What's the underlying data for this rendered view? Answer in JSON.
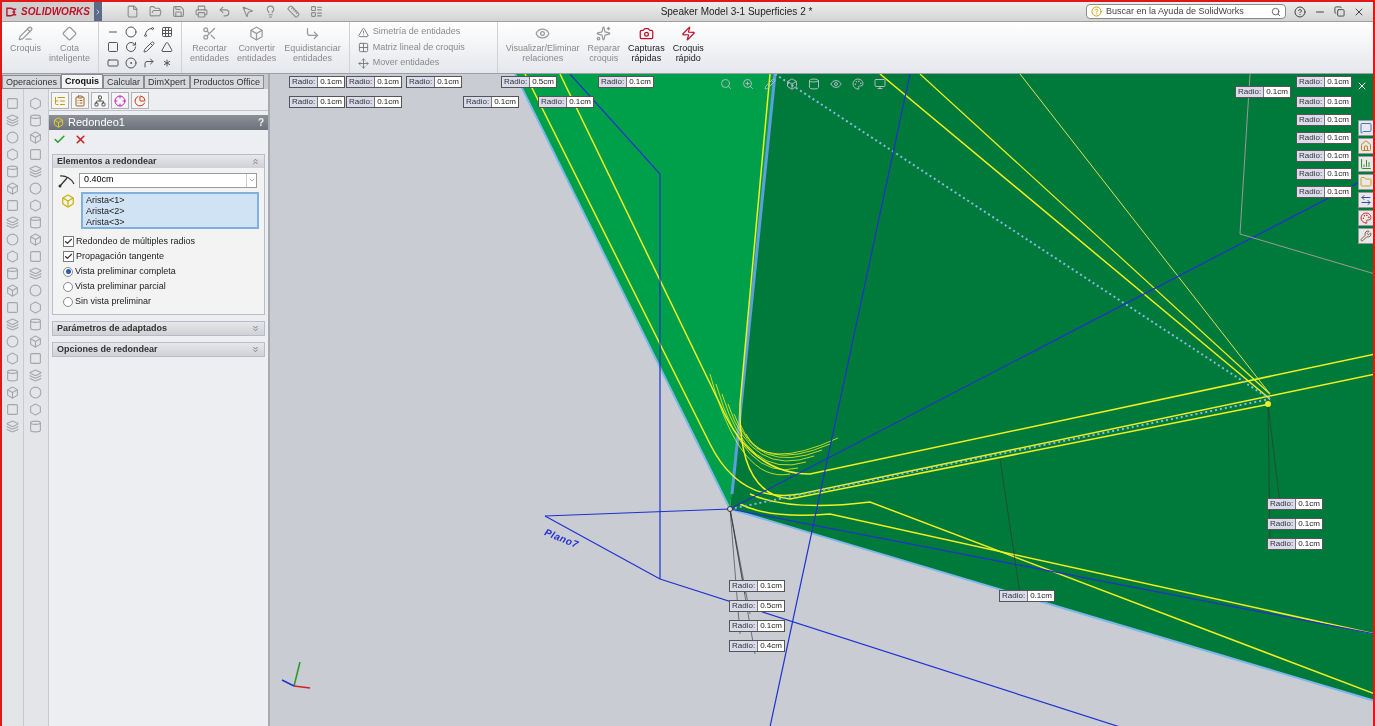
{
  "window": {
    "app_name": "SOLIDWORKS",
    "title": "Speaker Model 3-1 Superficies 2 *",
    "help_search": {
      "placeholder": "Buscar en la Ayuda de SolidWorks"
    }
  },
  "ribbon": [
    {
      "kind": "button",
      "lines": [
        "Croquis"
      ],
      "disabled": true
    },
    {
      "kind": "button",
      "lines": [
        "Cota",
        "inteligente"
      ],
      "disabled": true
    },
    {
      "kind": "tool_grid"
    },
    {
      "kind": "button",
      "lines": [
        "Recortar",
        "entidades"
      ],
      "disabled": true
    },
    {
      "kind": "button",
      "lines": [
        "Convertir",
        "entidades"
      ],
      "disabled": true
    },
    {
      "kind": "button",
      "lines": [
        "Equidistanciar",
        "entidades"
      ],
      "disabled": true
    },
    {
      "kind": "stack",
      "items": [
        {
          "label": "Simetría de entidades",
          "disabled": true
        },
        {
          "label": "Matriz lineal de croquis",
          "disabled": true
        },
        {
          "label": "Mover entidades",
          "disabled": true
        }
      ]
    },
    {
      "kind": "button",
      "lines": [
        "Visualizar/Eliminar",
        "relaciones"
      ],
      "disabled": true
    },
    {
      "kind": "button",
      "lines": [
        "Reparar",
        "croquis"
      ],
      "disabled": true
    },
    {
      "kind": "button",
      "lines": [
        "Capturas",
        "rápidas"
      ],
      "disabled": false
    },
    {
      "kind": "button",
      "lines": [
        "Croquis",
        "rápido"
      ],
      "disabled": false
    }
  ],
  "command_tabs": [
    {
      "label": "Operaciones",
      "selected": false
    },
    {
      "label": "Croquis",
      "selected": true
    },
    {
      "label": "Calcular",
      "selected": false
    },
    {
      "label": "DimXpert",
      "selected": false
    },
    {
      "label": "Productos Office",
      "selected": false
    }
  ],
  "property_manager": {
    "title": "Redondeo1",
    "help": "?",
    "main_section": {
      "title": "Elementos a redondear",
      "expanded": true,
      "radius": "0.40cm",
      "edges": [
        "Arista<1>",
        "Arista<2>",
        "Arista<3>"
      ],
      "options": [
        {
          "kind": "checkbox",
          "label": "Redondeo de múltiples radios",
          "checked": true
        },
        {
          "kind": "checkbox",
          "label": "Propagación tangente",
          "checked": true
        },
        {
          "kind": "radio",
          "label": "Vista preliminar completa",
          "selected": true
        },
        {
          "kind": "radio",
          "label": "Vista preliminar parcial",
          "selected": false
        },
        {
          "kind": "radio",
          "label": "Sin vista preliminar",
          "selected": false
        }
      ]
    },
    "other_sections": [
      {
        "title": "Parámetros de adaptados",
        "expanded": false
      },
      {
        "title": "Opciones de redondear",
        "expanded": false
      }
    ]
  },
  "viewport": {
    "plane_label": "Plano7",
    "callouts": [
      {
        "label": "Radio:",
        "value": "0.1cm"
      },
      {
        "label": "Radio:",
        "value": "0.1cm"
      },
      {
        "label": "Radio:",
        "value": "0.1cm"
      },
      {
        "label": "Radio:",
        "value": "0.5cm"
      },
      {
        "label": "Radio:",
        "value": "0.1cm"
      },
      {
        "label": "Radio:",
        "value": "0.1cm"
      },
      {
        "label": "Radio:",
        "value": "0.1cm"
      },
      {
        "label": "Radio:",
        "value": "0.1cm"
      },
      {
        "label": "Radio:",
        "value": "0.1cm"
      },
      {
        "label": "Radio:",
        "value": "0.1cm"
      },
      {
        "label": "Radio:",
        "value": "0.1cm"
      },
      {
        "label": "Radio:",
        "value": "0.1cm"
      },
      {
        "label": "Radio:",
        "value": "0.1cm"
      },
      {
        "label": "Radio:",
        "value": "0.1cm"
      },
      {
        "label": "Radio:",
        "value": "0.1cm"
      },
      {
        "label": "Radio:",
        "value": "0.1cm"
      },
      {
        "label": "Radio:",
        "value": "0.1cm"
      },
      {
        "label": "Radio:",
        "value": "0.1cm"
      },
      {
        "label": "Radio:",
        "value": "0.1cm"
      },
      {
        "label": "Radio:",
        "value": "0.1cm"
      },
      {
        "label": "Radio:",
        "value": "0.1cm"
      },
      {
        "label": "Radio:",
        "value": "0.1cm"
      },
      {
        "label": "Radio:",
        "value": "0.5cm"
      },
      {
        "label": "Radio:",
        "value": "0.1cm"
      },
      {
        "label": "Radio:",
        "value": "0.4cm"
      }
    ]
  }
}
